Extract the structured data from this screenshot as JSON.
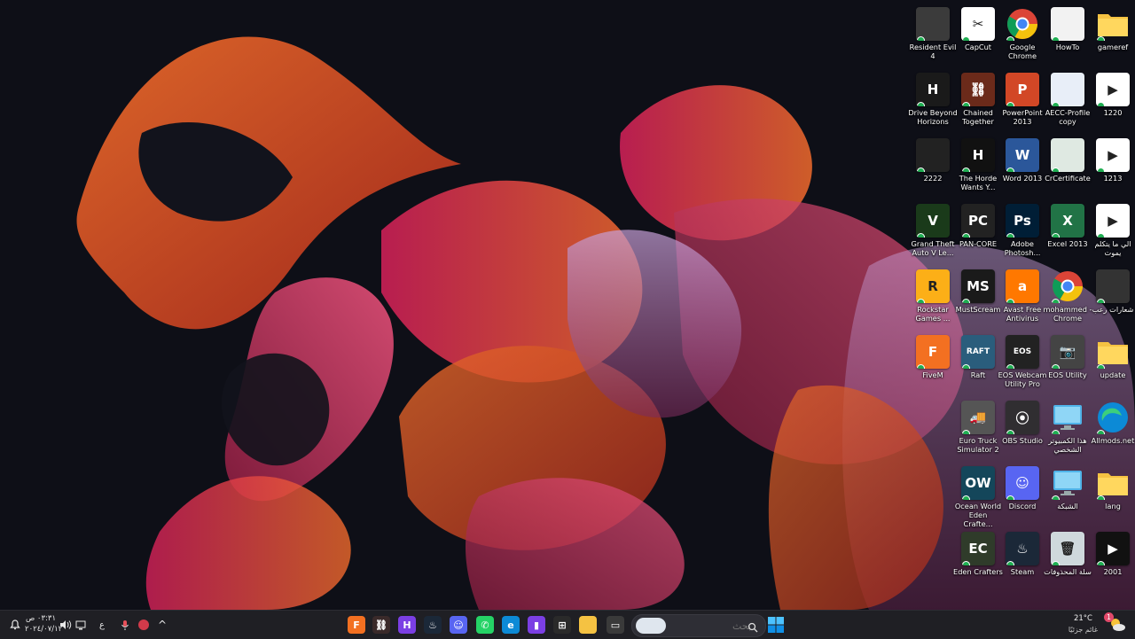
{
  "desktop_icons": [
    {
      "label": "Resident Evil 4",
      "icon": "resident-evil-icon",
      "bg": "#3b3b3b",
      "glyph": ""
    },
    {
      "label": "CapCut",
      "icon": "capcut-icon",
      "bg": "#ffffff",
      "glyph": "✂"
    },
    {
      "label": "Google Chrome",
      "icon": "chrome-icon",
      "bg": "chrome",
      "glyph": ""
    },
    {
      "label": "HowTo",
      "icon": "pdf-icon",
      "bg": "#f2f2f2",
      "glyph": ""
    },
    {
      "label": "gameref",
      "icon": "folder-icon",
      "bg": "folder",
      "glyph": ""
    },
    {
      "label": "Drive Beyond Horizons",
      "icon": "drive-beyond-horizons-icon",
      "bg": "#1a1a1a",
      "glyph": "H"
    },
    {
      "label": "Chained Together",
      "icon": "chained-together-icon",
      "bg": "#6b2a1a",
      "glyph": "⛓"
    },
    {
      "label": "PowerPoint 2013",
      "icon": "powerpoint-icon",
      "bg": "#d24726",
      "glyph": "P"
    },
    {
      "label": "AECC-Profile copy",
      "icon": "pdf-document-icon",
      "bg": "#e8eef8",
      "glyph": ""
    },
    {
      "label": "1220",
      "icon": "video-file-icon",
      "bg": "#ffffff",
      "glyph": "▶"
    },
    {
      "label": "2222",
      "icon": "image-file-icon",
      "bg": "#222222",
      "glyph": ""
    },
    {
      "label": "The Horde Wants Y...",
      "icon": "the-horde-icon",
      "bg": "#111111",
      "glyph": "H"
    },
    {
      "label": "Word 2013",
      "icon": "word-icon",
      "bg": "#2b579a",
      "glyph": "W"
    },
    {
      "label": "CrCertificate",
      "icon": "certificate-icon",
      "bg": "#dfe9e2",
      "glyph": ""
    },
    {
      "label": "1213",
      "icon": "video-file-icon",
      "bg": "#ffffff",
      "glyph": "▶"
    },
    {
      "label": "Grand Theft Auto V Le...",
      "icon": "gta-v-icon",
      "bg": "#1a3a1a",
      "glyph": "V"
    },
    {
      "label": "PAN-CORE",
      "icon": "pan-core-icon",
      "bg": "#222222",
      "glyph": "PC"
    },
    {
      "label": "Adobe Photosh...",
      "icon": "photoshop-icon",
      "bg": "#001e36",
      "glyph": "Ps"
    },
    {
      "label": "Excel 2013",
      "icon": "excel-icon",
      "bg": "#217346",
      "glyph": "X"
    },
    {
      "label": "الي ما يتكلم يموت",
      "icon": "video-file-icon",
      "bg": "#ffffff",
      "glyph": "▶"
    },
    {
      "label": "Rockstar Games ...",
      "icon": "rockstar-icon",
      "bg": "#fcaf17",
      "glyph": "R"
    },
    {
      "label": "MustScream",
      "icon": "mustscream-icon",
      "bg": "#1a1a1a",
      "glyph": "MS"
    },
    {
      "label": "Avast Free Antivirus",
      "icon": "avast-icon",
      "bg": "#ff7800",
      "glyph": "a"
    },
    {
      "label": "mohammed - Chrome",
      "icon": "chrome-profile-icon",
      "bg": "chrome",
      "glyph": ""
    },
    {
      "label": "شعارات رعب",
      "icon": "image-file-icon",
      "bg": "#333333",
      "glyph": ""
    },
    {
      "label": "FiveM",
      "icon": "fivem-icon",
      "bg": "#f37021",
      "glyph": "F"
    },
    {
      "label": "Raft",
      "icon": "raft-icon",
      "bg": "#2a5d7c",
      "glyph": "RAFT"
    },
    {
      "label": "EOS Webcam Utility Pro",
      "icon": "eos-webcam-icon",
      "bg": "#222222",
      "glyph": "EOS"
    },
    {
      "label": "EOS Utility",
      "icon": "eos-utility-icon",
      "bg": "#444444",
      "glyph": "📷"
    },
    {
      "label": "update",
      "icon": "folder-icon",
      "bg": "folder",
      "glyph": ""
    },
    {
      "label": "Euro Truck Simulator 2",
      "icon": "euro-truck-icon",
      "bg": "#555555",
      "glyph": "🚚"
    },
    {
      "label": "OBS Studio",
      "icon": "obs-icon",
      "bg": "#302e31",
      "glyph": "⦿"
    },
    {
      "label": "هذا الكمبيوتر الشخصي",
      "icon": "this-pc-icon",
      "bg": "monitor",
      "glyph": ""
    },
    {
      "label": "Allmods.net",
      "icon": "edge-icon",
      "bg": "edge",
      "glyph": ""
    },
    {
      "label": "Ocean World Eden Crafte...",
      "icon": "ocean-world-icon",
      "bg": "#14465a",
      "glyph": "OW"
    },
    {
      "label": "Discord",
      "icon": "discord-icon",
      "bg": "#5865f2",
      "glyph": "☺"
    },
    {
      "label": "الشبكة",
      "icon": "network-icon",
      "bg": "monitor",
      "glyph": ""
    },
    {
      "label": "lang",
      "icon": "folder-icon",
      "bg": "folder",
      "glyph": ""
    },
    {
      "label": "Eden Crafters",
      "icon": "eden-crafters-icon",
      "bg": "#2f3b2a",
      "glyph": "EC"
    },
    {
      "label": "Steam",
      "icon": "steam-icon",
      "bg": "#1b2838",
      "glyph": "♨"
    },
    {
      "label": "سلة المحذوفات",
      "icon": "recycle-bin-icon",
      "bg": "#cfd8dc",
      "glyph": "🗑"
    },
    {
      "label": "2001",
      "icon": "video-file-icon",
      "bg": "#111111",
      "glyph": "▶"
    }
  ],
  "taskbar": {
    "start_label": "Start",
    "search_placeholder": "بحث",
    "pinned": [
      {
        "name": "fivem-taskbar-icon",
        "bg": "#f37021",
        "glyph": "F"
      },
      {
        "name": "chained-together-taskbar-icon",
        "bg": "#3a2a2a",
        "glyph": "⛓"
      },
      {
        "name": "drive-beyond-taskbar-icon",
        "bg": "#7b3fe4",
        "glyph": "H"
      },
      {
        "name": "steam-taskbar-icon",
        "bg": "#1b2838",
        "glyph": "♨"
      },
      {
        "name": "discord-taskbar-icon",
        "bg": "#5865f2",
        "glyph": "☺"
      },
      {
        "name": "whatsapp-taskbar-icon",
        "bg": "#25d366",
        "glyph": "✆"
      },
      {
        "name": "edge-taskbar-icon",
        "bg": "#0c8ad6",
        "glyph": "e"
      },
      {
        "name": "clipchamp-taskbar-icon",
        "bg": "#7b3fe4",
        "glyph": "▮"
      },
      {
        "name": "store-taskbar-icon",
        "bg": "#2a2a2a",
        "glyph": "⊞"
      },
      {
        "name": "file-explorer-taskbar-icon",
        "bg": "#f5c242",
        "glyph": ""
      },
      {
        "name": "window-taskbar-icon",
        "bg": "#3a3a3a",
        "glyph": "▭"
      }
    ],
    "weather_temp": "21°C",
    "weather_desc": "غائم جزئيًا",
    "weather_badge": "1",
    "time": "٠٣:٣١ ص",
    "date": "٢٠٢٤/٠٧/١٢",
    "language": "ع",
    "tray_chevron": "^"
  },
  "colors": {
    "taskbar_bg": "#1f1f24",
    "accent": "#0078d4"
  }
}
